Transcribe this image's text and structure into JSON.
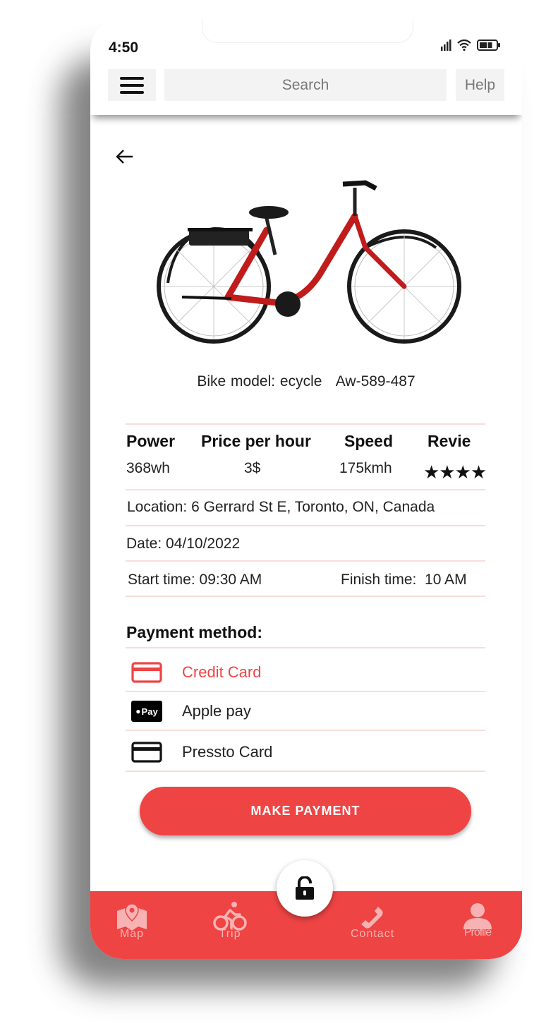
{
  "status_bar": {
    "time": "4:50",
    "icons": [
      "signal-icon",
      "wifi-icon",
      "battery-icon"
    ]
  },
  "header": {
    "menu_icon": "hamburger-menu-icon",
    "search_placeholder": "Search",
    "help_label": "Help"
  },
  "bike": {
    "model_text": "Bike model: ecycle   Aw-589-487",
    "image": "red-electric-bike-image"
  },
  "specs": {
    "headers": [
      "Power",
      "Price per hour",
      "Speed",
      "Revie"
    ],
    "values": [
      "368wh",
      "3$",
      "175kmh",
      "★★★★"
    ],
    "rating": 4
  },
  "details": {
    "location": "Location: 6 Gerrard St E, Toronto, ON, Canada",
    "date": "Date: 04/10/2022",
    "start_time": "Start time: 09:30 AM",
    "finish_time": "Finish time:  10 AM"
  },
  "payment": {
    "title": "Payment method:",
    "methods": [
      {
        "label": "Credit Card",
        "icon": "credit-card-icon",
        "selected": true
      },
      {
        "label": "Apple pay",
        "icon": "apple-pay-icon",
        "selected": false
      },
      {
        "label": "Pressto Card",
        "icon": "card-icon",
        "selected": false
      }
    ],
    "apple_pay_badge": "Pay",
    "button_label": "MAKE PAYMENT"
  },
  "bottom_nav": {
    "items": [
      {
        "label": "Map",
        "icon": "map-icon"
      },
      {
        "label": "Trip",
        "icon": "bicycle-icon"
      },
      {
        "label": "Contact",
        "icon": "phone-icon"
      },
      {
        "label": "Profile",
        "icon": "user-icon"
      }
    ],
    "center_icon": "unlock-icon"
  },
  "colors": {
    "accent": "#ef4444",
    "divider": "#f7ddd9",
    "nav_icon": "#f7b3b3",
    "input_bg": "#f3f3f3"
  }
}
